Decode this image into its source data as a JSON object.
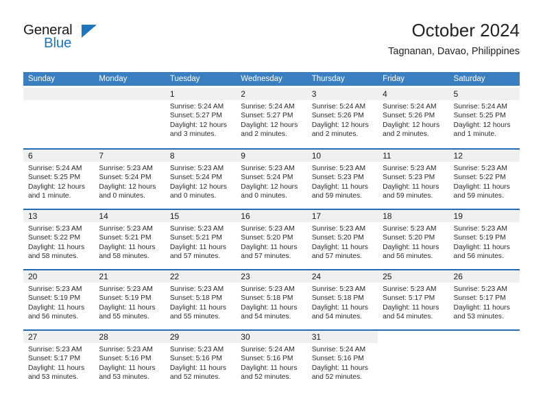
{
  "logo": {
    "word_top": "General",
    "word_bottom": "Blue",
    "triangle_icon": "blue-triangle-icon",
    "accent_color": "#1d76bd"
  },
  "header": {
    "title": "October 2024",
    "location": "Tagnanan, Davao, Philippines"
  },
  "calendar": {
    "header_bg": "#3a7fc1",
    "row_border": "#1f6cb0",
    "day_strip_bg": "#f0f0f0",
    "weekdays": [
      "Sunday",
      "Monday",
      "Tuesday",
      "Wednesday",
      "Thursday",
      "Friday",
      "Saturday"
    ],
    "weeks": [
      [
        {
          "day": "",
          "lines": []
        },
        {
          "day": "",
          "lines": []
        },
        {
          "day": "1",
          "lines": [
            "Sunrise: 5:24 AM",
            "Sunset: 5:27 PM",
            "Daylight: 12 hours",
            "and 3 minutes."
          ]
        },
        {
          "day": "2",
          "lines": [
            "Sunrise: 5:24 AM",
            "Sunset: 5:27 PM",
            "Daylight: 12 hours",
            "and 2 minutes."
          ]
        },
        {
          "day": "3",
          "lines": [
            "Sunrise: 5:24 AM",
            "Sunset: 5:26 PM",
            "Daylight: 12 hours",
            "and 2 minutes."
          ]
        },
        {
          "day": "4",
          "lines": [
            "Sunrise: 5:24 AM",
            "Sunset: 5:26 PM",
            "Daylight: 12 hours",
            "and 2 minutes."
          ]
        },
        {
          "day": "5",
          "lines": [
            "Sunrise: 5:24 AM",
            "Sunset: 5:25 PM",
            "Daylight: 12 hours",
            "and 1 minute."
          ]
        }
      ],
      [
        {
          "day": "6",
          "lines": [
            "Sunrise: 5:24 AM",
            "Sunset: 5:25 PM",
            "Daylight: 12 hours",
            "and 1 minute."
          ]
        },
        {
          "day": "7",
          "lines": [
            "Sunrise: 5:23 AM",
            "Sunset: 5:24 PM",
            "Daylight: 12 hours",
            "and 0 minutes."
          ]
        },
        {
          "day": "8",
          "lines": [
            "Sunrise: 5:23 AM",
            "Sunset: 5:24 PM",
            "Daylight: 12 hours",
            "and 0 minutes."
          ]
        },
        {
          "day": "9",
          "lines": [
            "Sunrise: 5:23 AM",
            "Sunset: 5:24 PM",
            "Daylight: 12 hours",
            "and 0 minutes."
          ]
        },
        {
          "day": "10",
          "lines": [
            "Sunrise: 5:23 AM",
            "Sunset: 5:23 PM",
            "Daylight: 11 hours",
            "and 59 minutes."
          ]
        },
        {
          "day": "11",
          "lines": [
            "Sunrise: 5:23 AM",
            "Sunset: 5:23 PM",
            "Daylight: 11 hours",
            "and 59 minutes."
          ]
        },
        {
          "day": "12",
          "lines": [
            "Sunrise: 5:23 AM",
            "Sunset: 5:22 PM",
            "Daylight: 11 hours",
            "and 59 minutes."
          ]
        }
      ],
      [
        {
          "day": "13",
          "lines": [
            "Sunrise: 5:23 AM",
            "Sunset: 5:22 PM",
            "Daylight: 11 hours",
            "and 58 minutes."
          ]
        },
        {
          "day": "14",
          "lines": [
            "Sunrise: 5:23 AM",
            "Sunset: 5:21 PM",
            "Daylight: 11 hours",
            "and 58 minutes."
          ]
        },
        {
          "day": "15",
          "lines": [
            "Sunrise: 5:23 AM",
            "Sunset: 5:21 PM",
            "Daylight: 11 hours",
            "and 57 minutes."
          ]
        },
        {
          "day": "16",
          "lines": [
            "Sunrise: 5:23 AM",
            "Sunset: 5:20 PM",
            "Daylight: 11 hours",
            "and 57 minutes."
          ]
        },
        {
          "day": "17",
          "lines": [
            "Sunrise: 5:23 AM",
            "Sunset: 5:20 PM",
            "Daylight: 11 hours",
            "and 57 minutes."
          ]
        },
        {
          "day": "18",
          "lines": [
            "Sunrise: 5:23 AM",
            "Sunset: 5:20 PM",
            "Daylight: 11 hours",
            "and 56 minutes."
          ]
        },
        {
          "day": "19",
          "lines": [
            "Sunrise: 5:23 AM",
            "Sunset: 5:19 PM",
            "Daylight: 11 hours",
            "and 56 minutes."
          ]
        }
      ],
      [
        {
          "day": "20",
          "lines": [
            "Sunrise: 5:23 AM",
            "Sunset: 5:19 PM",
            "Daylight: 11 hours",
            "and 56 minutes."
          ]
        },
        {
          "day": "21",
          "lines": [
            "Sunrise: 5:23 AM",
            "Sunset: 5:19 PM",
            "Daylight: 11 hours",
            "and 55 minutes."
          ]
        },
        {
          "day": "22",
          "lines": [
            "Sunrise: 5:23 AM",
            "Sunset: 5:18 PM",
            "Daylight: 11 hours",
            "and 55 minutes."
          ]
        },
        {
          "day": "23",
          "lines": [
            "Sunrise: 5:23 AM",
            "Sunset: 5:18 PM",
            "Daylight: 11 hours",
            "and 54 minutes."
          ]
        },
        {
          "day": "24",
          "lines": [
            "Sunrise: 5:23 AM",
            "Sunset: 5:18 PM",
            "Daylight: 11 hours",
            "and 54 minutes."
          ]
        },
        {
          "day": "25",
          "lines": [
            "Sunrise: 5:23 AM",
            "Sunset: 5:17 PM",
            "Daylight: 11 hours",
            "and 54 minutes."
          ]
        },
        {
          "day": "26",
          "lines": [
            "Sunrise: 5:23 AM",
            "Sunset: 5:17 PM",
            "Daylight: 11 hours",
            "and 53 minutes."
          ]
        }
      ],
      [
        {
          "day": "27",
          "lines": [
            "Sunrise: 5:23 AM",
            "Sunset: 5:17 PM",
            "Daylight: 11 hours",
            "and 53 minutes."
          ]
        },
        {
          "day": "28",
          "lines": [
            "Sunrise: 5:23 AM",
            "Sunset: 5:16 PM",
            "Daylight: 11 hours",
            "and 53 minutes."
          ]
        },
        {
          "day": "29",
          "lines": [
            "Sunrise: 5:23 AM",
            "Sunset: 5:16 PM",
            "Daylight: 11 hours",
            "and 52 minutes."
          ]
        },
        {
          "day": "30",
          "lines": [
            "Sunrise: 5:24 AM",
            "Sunset: 5:16 PM",
            "Daylight: 11 hours",
            "and 52 minutes."
          ]
        },
        {
          "day": "31",
          "lines": [
            "Sunrise: 5:24 AM",
            "Sunset: 5:16 PM",
            "Daylight: 11 hours",
            "and 52 minutes."
          ]
        },
        {
          "day": "",
          "lines": [],
          "blank": true
        },
        {
          "day": "",
          "lines": [],
          "blank": true
        }
      ]
    ]
  }
}
